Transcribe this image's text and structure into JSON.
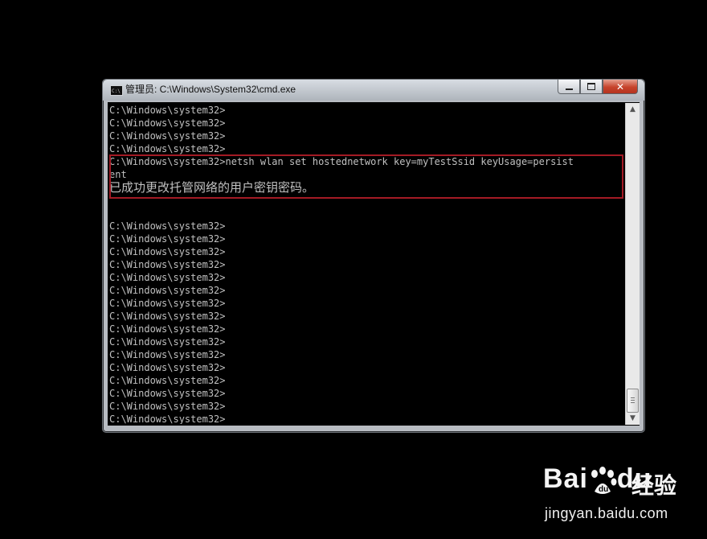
{
  "window": {
    "title": "管理员: C:\\Windows\\System32\\cmd.exe",
    "icon": "cmd-icon"
  },
  "controls": {
    "minimize_icon": "minimize-icon",
    "maximize_icon": "maximize-icon",
    "close_icon": "close-icon"
  },
  "console": {
    "lines": [
      "C:\\Windows\\system32>",
      "C:\\Windows\\system32>",
      "C:\\Windows\\system32>",
      "C:\\Windows\\system32>",
      "C:\\Windows\\system32>netsh wlan set hostednetwork key=myTestSsid keyUsage=persist",
      "ent",
      "已成功更改托管网络的用户密钥密码。",
      "",
      "",
      "C:\\Windows\\system32>",
      "C:\\Windows\\system32>",
      "C:\\Windows\\system32>",
      "C:\\Windows\\system32>",
      "C:\\Windows\\system32>",
      "C:\\Windows\\system32>",
      "C:\\Windows\\system32>",
      "C:\\Windows\\system32>",
      "C:\\Windows\\system32>",
      "C:\\Windows\\system32>",
      "C:\\Windows\\system32>",
      "C:\\Windows\\system32>",
      "C:\\Windows\\system32>",
      "C:\\Windows\\system32>",
      "C:\\Windows\\system32>",
      "C:\\Windows\\system32>"
    ],
    "highlight_color": "#a31a24"
  },
  "scrollbar": {
    "position_fraction": 0.95
  },
  "watermark": {
    "brand_left": "Bai",
    "brand_right": "du",
    "product": "经验",
    "url": "jingyan.baidu.com"
  }
}
